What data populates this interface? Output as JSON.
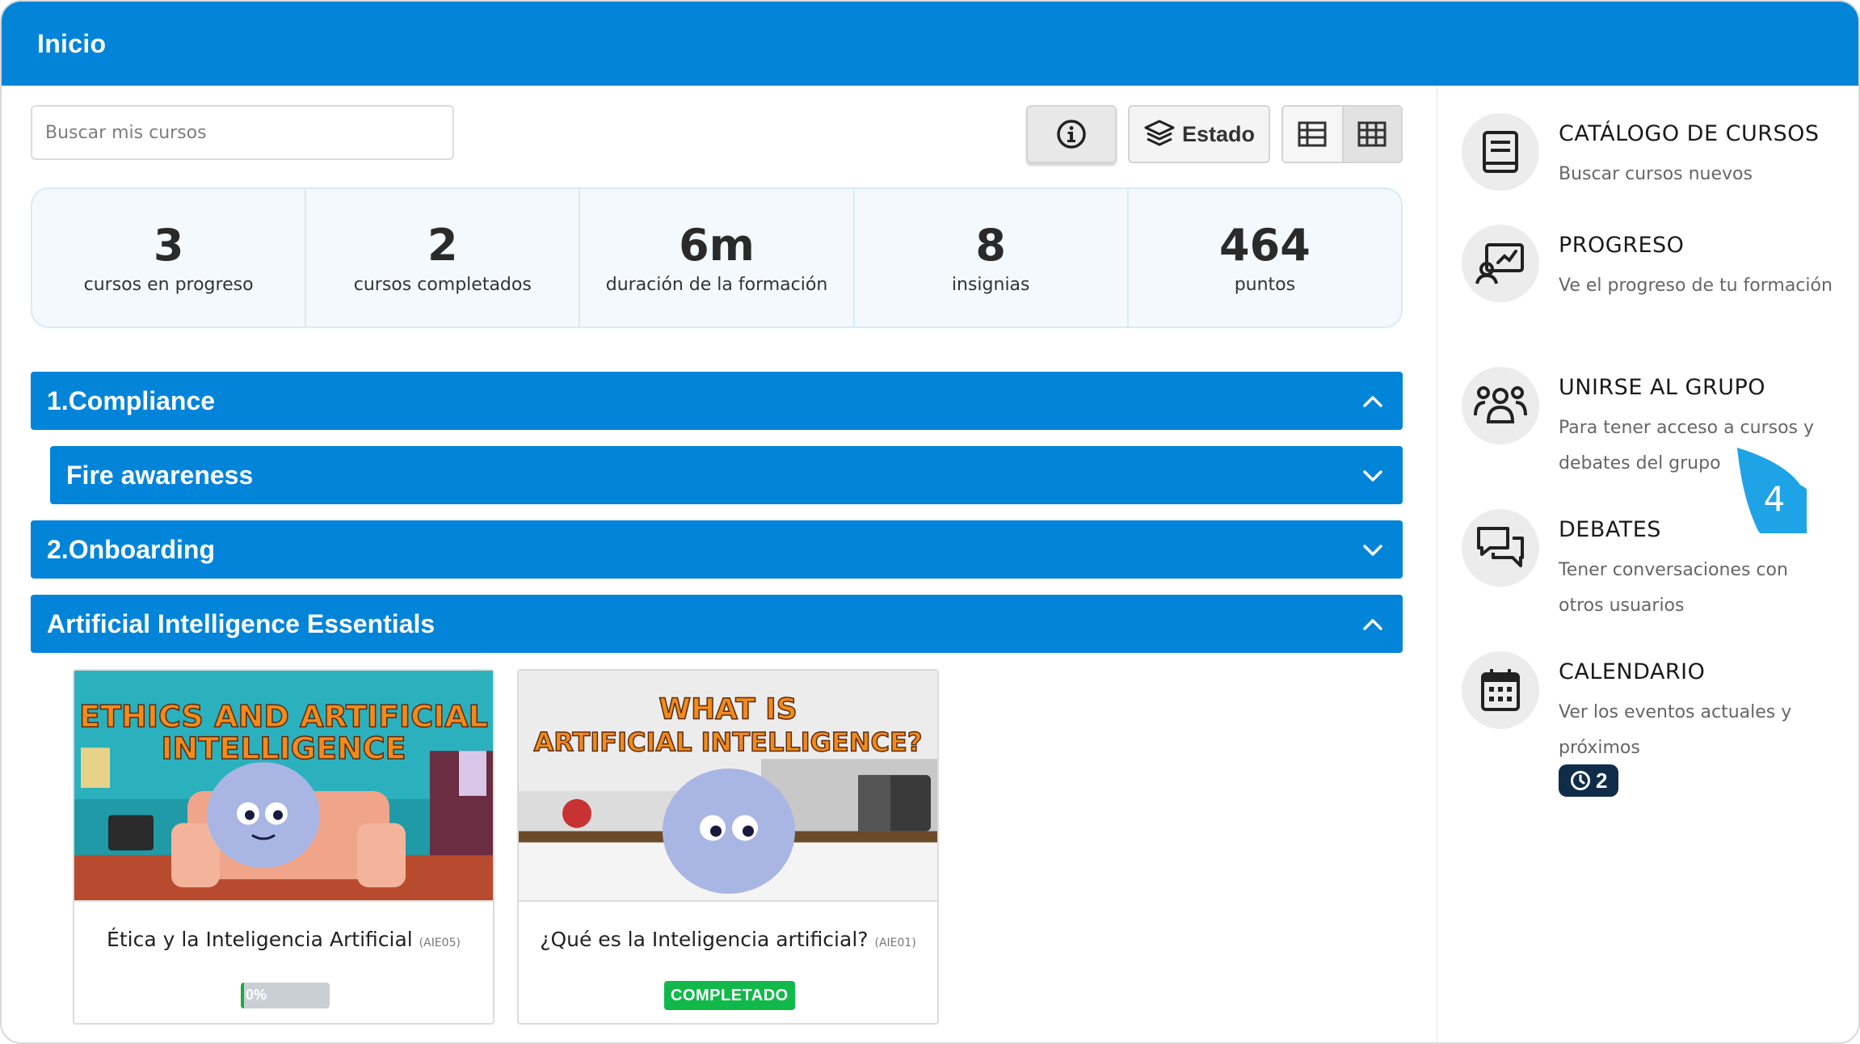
{
  "header": {
    "title": "Inicio"
  },
  "search": {
    "placeholder": "Buscar mis cursos"
  },
  "toolbar": {
    "info_icon": "info-circle-icon",
    "estado_label": "Estado",
    "view_list_icon": "table-list-icon",
    "view_grid_icon": "grid-icon",
    "active_view": "grid"
  },
  "stats": [
    {
      "value": "3",
      "label": "cursos en progreso"
    },
    {
      "value": "2",
      "label": "cursos completados"
    },
    {
      "value": "6m",
      "label": "duración de la formación"
    },
    {
      "value": "8",
      "label": "insignias"
    },
    {
      "value": "464",
      "label": "puntos"
    }
  ],
  "sections": [
    {
      "label": "1.Compliance",
      "expanded": true
    },
    {
      "label": "Fire awareness",
      "expanded": false
    },
    {
      "label": "2.Onboarding",
      "expanded": false
    },
    {
      "label": "Artificial Intelligence Essentials",
      "expanded": true
    }
  ],
  "courses": [
    {
      "thumb_text_line1": "ETHICS AND ARTIFICIAL",
      "thumb_text_line2": "INTELLIGENCE",
      "title": "Ética y la Inteligencia Artificial",
      "code": "(AIE05)",
      "progress_percent": 0,
      "progress_label": "0%"
    },
    {
      "thumb_text_line1": "WHAT IS",
      "thumb_text_line2": "ARTIFICIAL INTELLIGENCE?",
      "title": "¿Qué es la Inteligencia artificial?",
      "code": "(AIE01)",
      "status_label": "COMPLETADO"
    }
  ],
  "side_nav": [
    {
      "icon": "book-icon",
      "title": "CATÁLOGO DE CURSOS",
      "desc": "Buscar cursos nuevos"
    },
    {
      "icon": "progress-chart-icon",
      "title": "PROGRESO",
      "desc": "Ve el progreso de tu formación"
    },
    {
      "icon": "group-icon",
      "title": "UNIRSE AL GRUPO",
      "desc": "Para tener acceso a cursos y debates del grupo"
    },
    {
      "icon": "chat-bubbles-icon",
      "title": "DEBATES",
      "desc": "Tener conversaciones con otros usuarios"
    },
    {
      "icon": "calendar-icon",
      "title": "CALENDARIO",
      "desc": "Ver los eventos actuales y próximos",
      "badge": "2"
    }
  ],
  "step_marker": {
    "number": "4",
    "color": "#1ea3e6"
  },
  "colors": {
    "primary": "#0284d9",
    "success": "#11b84a",
    "badge_dark": "#0f2d49"
  }
}
